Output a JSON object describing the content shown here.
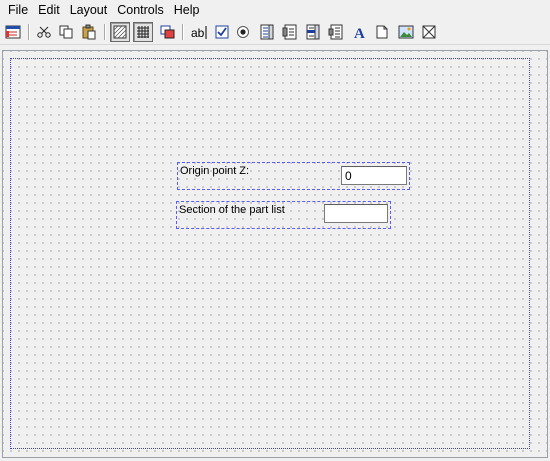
{
  "menubar": {
    "items": [
      "File",
      "Edit",
      "Layout",
      "Controls",
      "Help"
    ]
  },
  "toolbar": {
    "buttons": [
      "form-properties-icon",
      "cut-icon",
      "copy-icon",
      "paste-icon",
      "grid-snap-icon",
      "grid-show-icon",
      "bring-front-icon",
      "textbox-tool-icon",
      "checkbox-tool-icon",
      "radio-tool-icon",
      "listbox-tool-icon",
      "combobox-tool-icon",
      "list-tool-icon",
      "spinner-tool-icon",
      "label-tool-icon",
      "frame-tool-icon",
      "image-tool-icon",
      "picture-tool-icon"
    ]
  },
  "form": {
    "fields": [
      {
        "label": "Origin point Z:",
        "value": "0"
      },
      {
        "label": "Section of the part list",
        "value": ""
      }
    ]
  }
}
